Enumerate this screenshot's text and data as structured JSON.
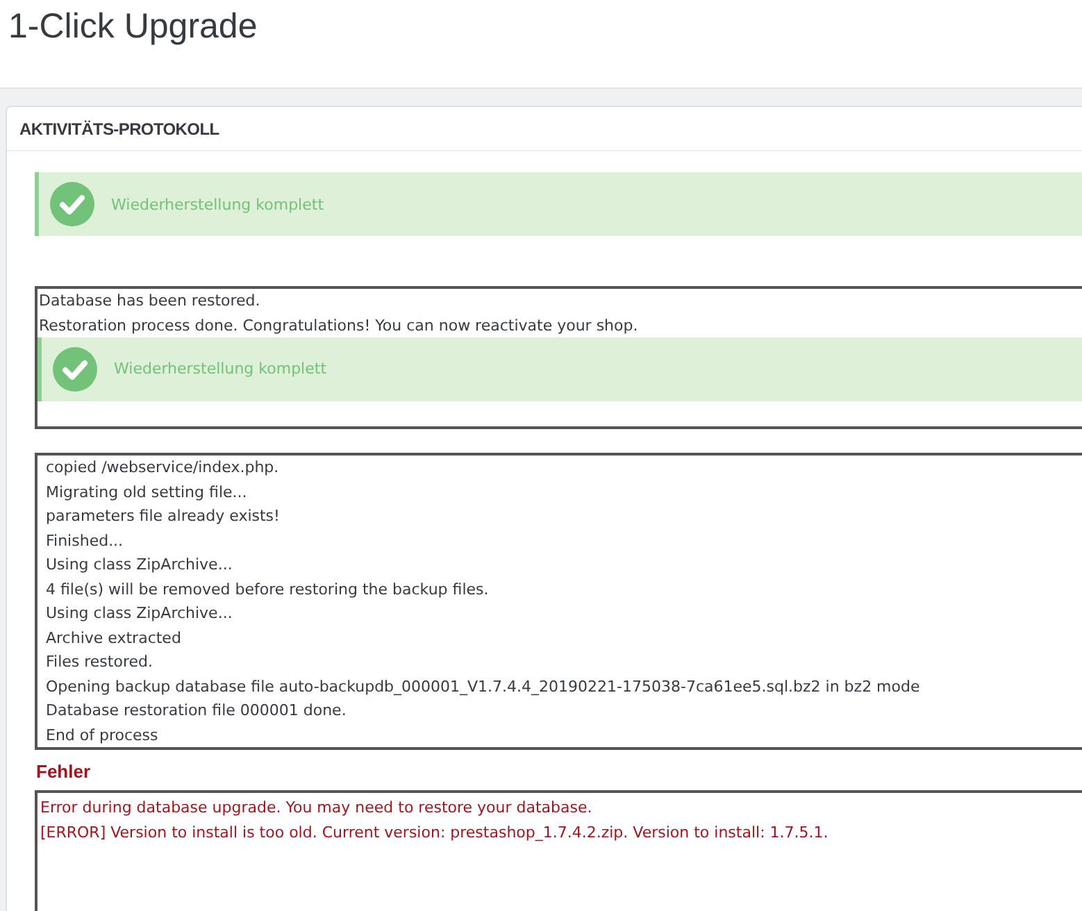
{
  "page_title": "1-Click Upgrade",
  "panel": {
    "title": "AKTIVITÄTS-PROTOKOLL",
    "alert": {
      "kind": "success",
      "text": "Wiederherstellung komplett"
    },
    "result_box": {
      "lines": [
        "Database has been restored.",
        "Restoration process done. Congratulations! You can now reactivate your shop."
      ],
      "alert": {
        "kind": "success",
        "text": "Wiederherstellung komplett"
      }
    },
    "log_lines": [
      "copied /webservice/index.php.",
      "Migrating old setting file...",
      "parameters file already exists!",
      "Finished...",
      "Using class ZipArchive...",
      "4 file(s) will be removed before restoring the backup files.",
      "Using class ZipArchive...",
      "Archive extracted",
      "Files restored.",
      "Opening backup database file auto-backupdb_000001_V1.7.4.4_20190221-175038-7ca61ee5.sql.bz2 in bz2 mode",
      "Database restoration file 000001 done.",
      "End of process"
    ],
    "errors": {
      "title": "Fehler",
      "lines": [
        "Error during database upgrade. You may need to restore your database.",
        "[ERROR] Version to install is too old. Current version: prestashop_1.7.4.2.zip. Version to install: 1.7.5.1."
      ]
    }
  }
}
